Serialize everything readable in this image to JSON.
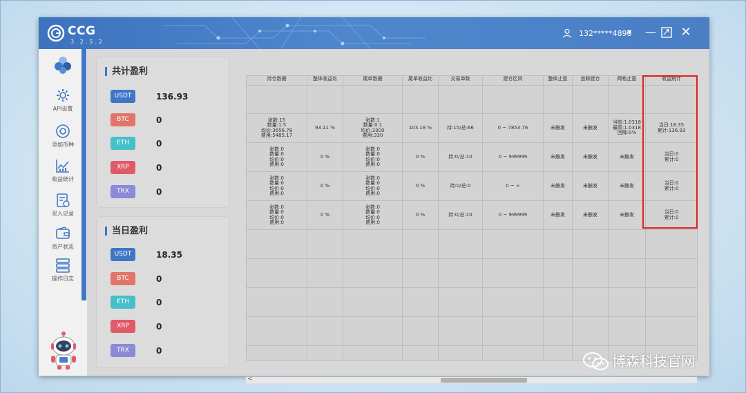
{
  "app": {
    "name": "CCG",
    "version": "3.2.5.2"
  },
  "user": {
    "account": "132*****4890"
  },
  "colors": {
    "titlebar": "#4a7fc6",
    "usdt": "#3f77c4",
    "btc": "#e0756a",
    "eth": "#46c0c8",
    "xrp": "#e05a6a",
    "trx": "#8a8ad6",
    "highlight": "#e02020"
  },
  "sidebar": {
    "items": [
      {
        "label": "API设置",
        "icon": "gear-icon"
      },
      {
        "label": "添加币种",
        "icon": "add-coin-icon"
      },
      {
        "label": "收益统计",
        "icon": "chart-icon"
      },
      {
        "label": "买入记录",
        "icon": "record-icon"
      },
      {
        "label": "资产状态",
        "icon": "wallet-icon"
      },
      {
        "label": "操作日志",
        "icon": "log-icon"
      }
    ]
  },
  "total_profit": {
    "title": "共计盈利",
    "coins": [
      {
        "name": "USDT",
        "value": "136.93"
      },
      {
        "name": "BTC",
        "value": "0"
      },
      {
        "name": "ETH",
        "value": "0"
      },
      {
        "name": "XRP",
        "value": "0"
      },
      {
        "name": "TRX",
        "value": "0"
      }
    ]
  },
  "daily_profit": {
    "title": "当日盈利",
    "coins": [
      {
        "name": "USDT",
        "value": "18.35"
      },
      {
        "name": "BTC",
        "value": "0"
      },
      {
        "name": "ETH",
        "value": "0"
      },
      {
        "name": "XRP",
        "value": "0"
      },
      {
        "name": "TRX",
        "value": "0"
      }
    ]
  },
  "table": {
    "headers": [
      "持仓数据",
      "整体收益比",
      "尾单数据",
      "尾单收益比",
      "交易单数",
      "建仓区间",
      "整体止盈",
      "追踪建仓",
      "网格止盈",
      "收益统计"
    ],
    "rows": [
      [
        "张数:15\n数量:1.5\n均价:3656.78\n费用:5485.17",
        "93.11 %",
        "张数:1\n数量:0.1\n均价:3300\n费用:330",
        "103.18 %",
        "持:15/总:66",
        "0 ~ 7853.76",
        "未触发",
        "未触发",
        "当前:1.0318\n最高:1.0318\n回降:0%",
        "当日:18.35\n累计:136.93"
      ],
      [
        "张数:0\n数量:0\n均价:0\n费用:0",
        "0 %",
        "张数:0\n数量:0\n均价:0\n费用:0",
        "0 %",
        "持:0/总:10",
        "0 ~ 999999",
        "未触发",
        "未触发",
        "未触发",
        "当日:0\n累计:0"
      ],
      [
        "张数:0\n数量:0\n均价:0\n费用:0",
        "0 %",
        "张数:0\n数量:0\n均价:0\n费用:0",
        "0 %",
        "持:0/总:0",
        "0 ~ ∞",
        "未触发",
        "未触发",
        "未触发",
        "当日:0\n累计:0"
      ],
      [
        "张数:0\n数量:0\n均价:0\n费用:0",
        "0 %",
        "张数:0\n数量:0\n均价:0\n费用:0",
        "0 %",
        "持:0/总:10",
        "0 ~ 999999",
        "未触发",
        "未触发",
        "未触发",
        "当日:0\n累计:0"
      ]
    ]
  },
  "scroll_left": "<",
  "watermark": {
    "text": "博森科技官网"
  }
}
